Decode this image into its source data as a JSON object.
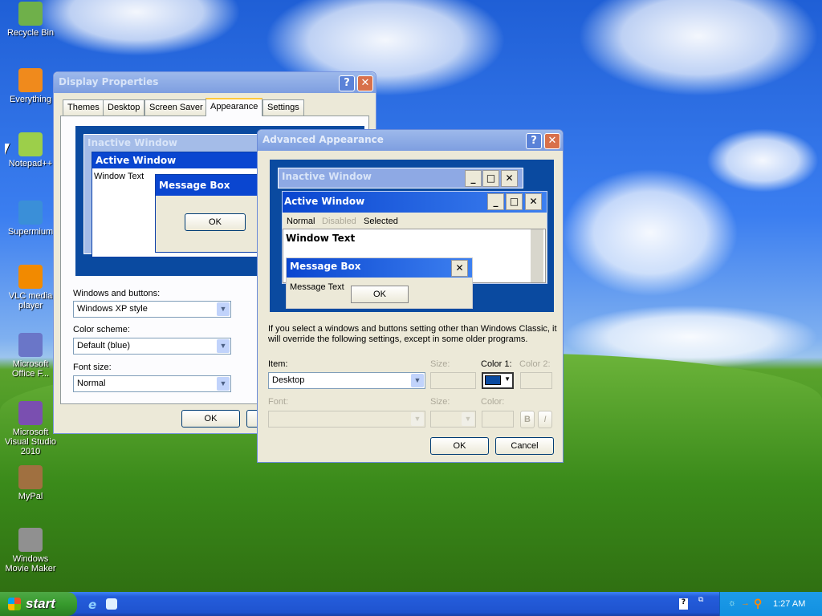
{
  "desktop": {
    "icons": [
      {
        "label": "Recycle Bin",
        "icon": "recycle-bin-icon",
        "color": "#6fb04a"
      },
      {
        "label": "Everything",
        "icon": "everything-search-icon",
        "color": "#f08a1c"
      },
      {
        "label": "Notepad++",
        "icon": "notepadpp-icon",
        "color": "#9ccf4a"
      },
      {
        "label": "Supermium",
        "icon": "supermium-browser-icon",
        "color": "#3a8fd8"
      },
      {
        "label": "VLC media player",
        "icon": "vlc-cone-icon",
        "color": "#f28a00"
      },
      {
        "label": "Microsoft Office F...",
        "icon": "office-icon",
        "color": "#6a76c8"
      },
      {
        "label": "Microsoft Visual Studio 2010",
        "icon": "visual-studio-icon",
        "color": "#7a4fb0"
      },
      {
        "label": "MyPal",
        "icon": "mypal-icon",
        "color": "#a07040"
      },
      {
        "label": "Windows Movie Maker",
        "icon": "movie-maker-icon",
        "color": "#909090"
      }
    ]
  },
  "display_properties": {
    "title": "Display Properties",
    "tabs": [
      {
        "label": "Themes"
      },
      {
        "label": "Desktop"
      },
      {
        "label": "Screen Saver"
      },
      {
        "label": "Appearance",
        "active": true
      },
      {
        "label": "Settings"
      }
    ],
    "preview": {
      "inactive": "Inactive Window",
      "active": "Active Window",
      "window_text": "Window Text",
      "message_box": "Message Box",
      "ok": "OK"
    },
    "windows_and_buttons_label": "Windows and buttons:",
    "windows_and_buttons_value": "Windows XP style",
    "color_scheme_label": "Color scheme:",
    "color_scheme_value": "Default (blue)",
    "font_size_label": "Font size:",
    "font_size_value": "Normal",
    "ok": "OK"
  },
  "advanced": {
    "title": "Advanced Appearance",
    "preview": {
      "inactive": "Inactive Window",
      "active": "Active Window",
      "menu_normal": "Normal",
      "menu_disabled": "Disabled",
      "menu_selected": "Selected",
      "window_text": "Window Text",
      "message_box": "Message Box",
      "message_text": "Message Text",
      "ok": "OK"
    },
    "note": "If you select a windows and buttons setting other than Windows Classic, it will override the following settings, except in some older programs.",
    "item_label": "Item:",
    "item_value": "Desktop",
    "size_label": "Size:",
    "color1_label": "Color 1:",
    "color2_label": "Color 2:",
    "color1_value": "#0a4aa0",
    "font_label": "Font:",
    "font_size_label": "Size:",
    "font_color_label": "Color:",
    "bold": "B",
    "italic": "I",
    "ok": "OK",
    "cancel": "Cancel"
  },
  "taskbar": {
    "start": "start",
    "clock": "1:27 AM"
  }
}
